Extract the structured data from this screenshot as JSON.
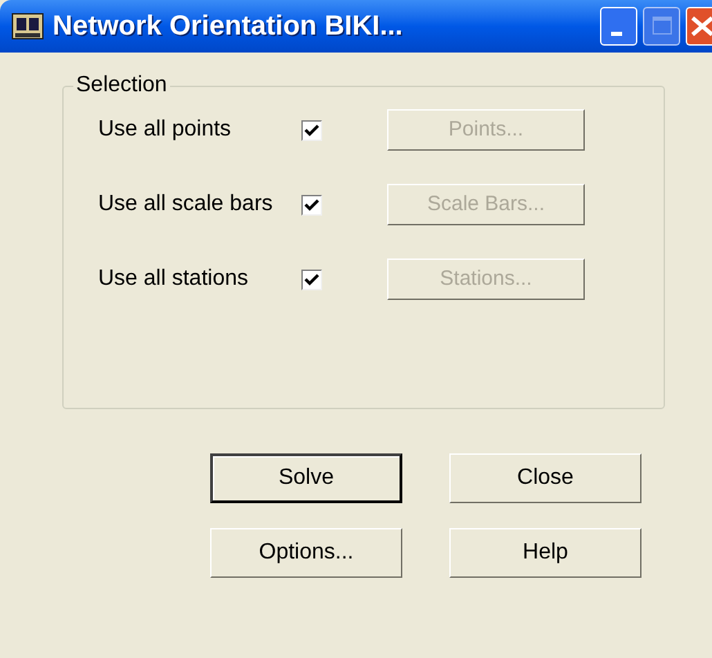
{
  "window": {
    "title": "Network Orientation  BIKI...",
    "controls": [
      {
        "kind": "minimize"
      },
      {
        "kind": "maximize"
      },
      {
        "kind": "close"
      }
    ]
  },
  "selection": {
    "title": "Selection",
    "rows": [
      {
        "label": "Use all points",
        "checked": true,
        "button": "Points...",
        "disabled": true
      },
      {
        "label": "Use all scale bars",
        "checked": true,
        "button": "Scale Bars...",
        "disabled": true
      },
      {
        "label": "Use all stations",
        "checked": true,
        "button": "Stations...",
        "disabled": true
      }
    ]
  },
  "buttons": [
    {
      "label": "Solve",
      "default": true
    },
    {
      "label": "Close",
      "default": false
    },
    {
      "label": "Options...",
      "default": false
    },
    {
      "label": "Help",
      "default": false
    }
  ]
}
